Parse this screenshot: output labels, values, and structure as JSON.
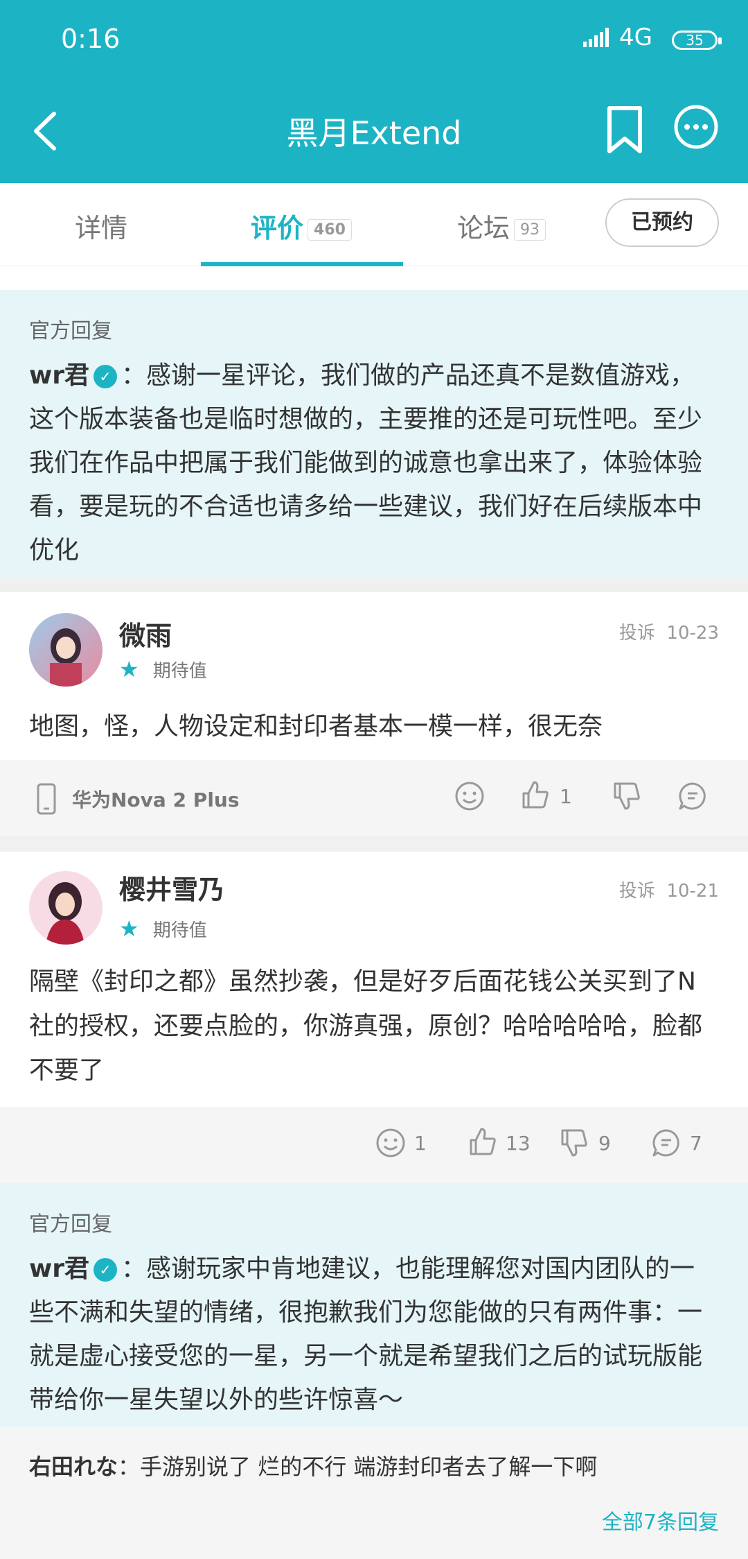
{
  "status_bar": {
    "time": "0:16",
    "network": "4G",
    "battery": "35"
  },
  "header": {
    "title": "黑月Extend"
  },
  "tabs": [
    {
      "label": "详情"
    },
    {
      "label": "评价",
      "count": "460"
    },
    {
      "label": "论坛",
      "count": "93"
    }
  ],
  "reserve_button": "已预约",
  "official_reply_1": {
    "tag": "官方回复",
    "author": "wr君",
    "text": "：感谢一星评论，我们做的产品还真不是数值游戏，这个版本装备也是临时想做的，主要推的还是可玩性吧。至少我们在作品中把属于我们能做到的诚意也拿出来了，体验体验看，要是玩的不合适也请多给一些建议，我们好在后续版本中优化"
  },
  "review_1": {
    "username": "微雨",
    "report": "投诉",
    "date": "10-23",
    "rating_label": "期待值",
    "text": "地图，怪，人物设定和封印者基本一模一样，很无奈",
    "device": "华为Nova 2 Plus",
    "likes": "1"
  },
  "review_2": {
    "username": "樱井雪乃",
    "report": "投诉",
    "date": "10-21",
    "rating_label": "期待值",
    "text": "隔壁《封印之都》虽然抄袭，但是好歹后面花钱公关买到了N社的授权，还要点脸的，你游真强，原创？哈哈哈哈哈，脸都不要了",
    "emoji_count": "1",
    "likes": "13",
    "dislikes": "9",
    "comments": "7"
  },
  "official_reply_2": {
    "tag": "官方回复",
    "author": "wr君",
    "text": "：感谢玩家中肯地建议，也能理解您对国内团队的一些不满和失望的情绪，很抱歉我们为您能做的只有两件事：一就是虚心接受您的一星，另一个就是希望我们之后的试玩版能带给你一星失望以外的些许惊喜～"
  },
  "sub_reply": {
    "author": "右田れな",
    "text": "：手游别说了 烂的不行 端游封印者去了解一下啊"
  },
  "all_replies_link": "全部7条回复"
}
